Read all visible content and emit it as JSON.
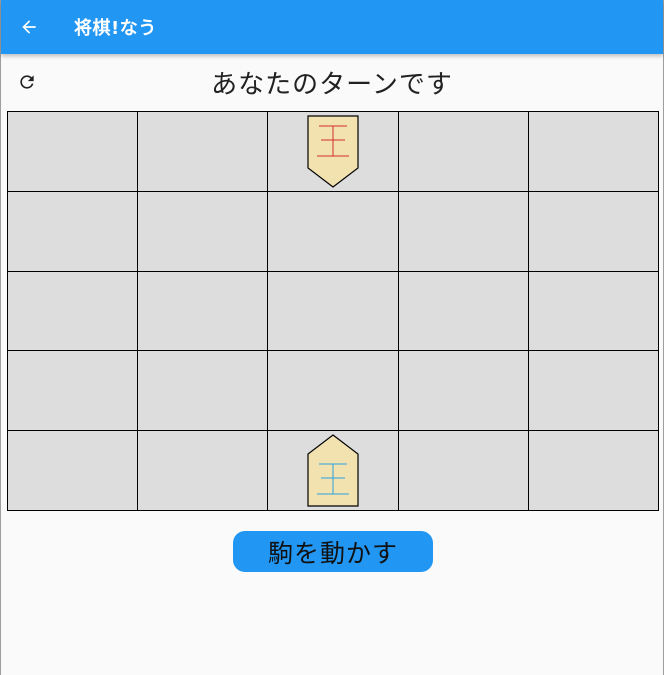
{
  "appbar": {
    "title": "将棋!なう",
    "back_icon": "arrow-back-icon"
  },
  "status": {
    "turn_message": "あなたのターンです",
    "reload_icon": "refresh-icon"
  },
  "board": {
    "rows": 5,
    "cols": 5,
    "cell_color": "#dddddd",
    "pieces": [
      {
        "name": "opponent-king",
        "label": "王",
        "row": 0,
        "col": 2,
        "owner": "opponent",
        "color": "#d32f2f"
      },
      {
        "name": "player-king",
        "label": "王",
        "row": 4,
        "col": 2,
        "owner": "player",
        "color": "#29a3e0"
      }
    ]
  },
  "actions": {
    "move_piece_label": "駒を動かす"
  },
  "colors": {
    "primary": "#2196f3",
    "piece_fill": "#f2e2b0",
    "background": "#fafafa"
  }
}
